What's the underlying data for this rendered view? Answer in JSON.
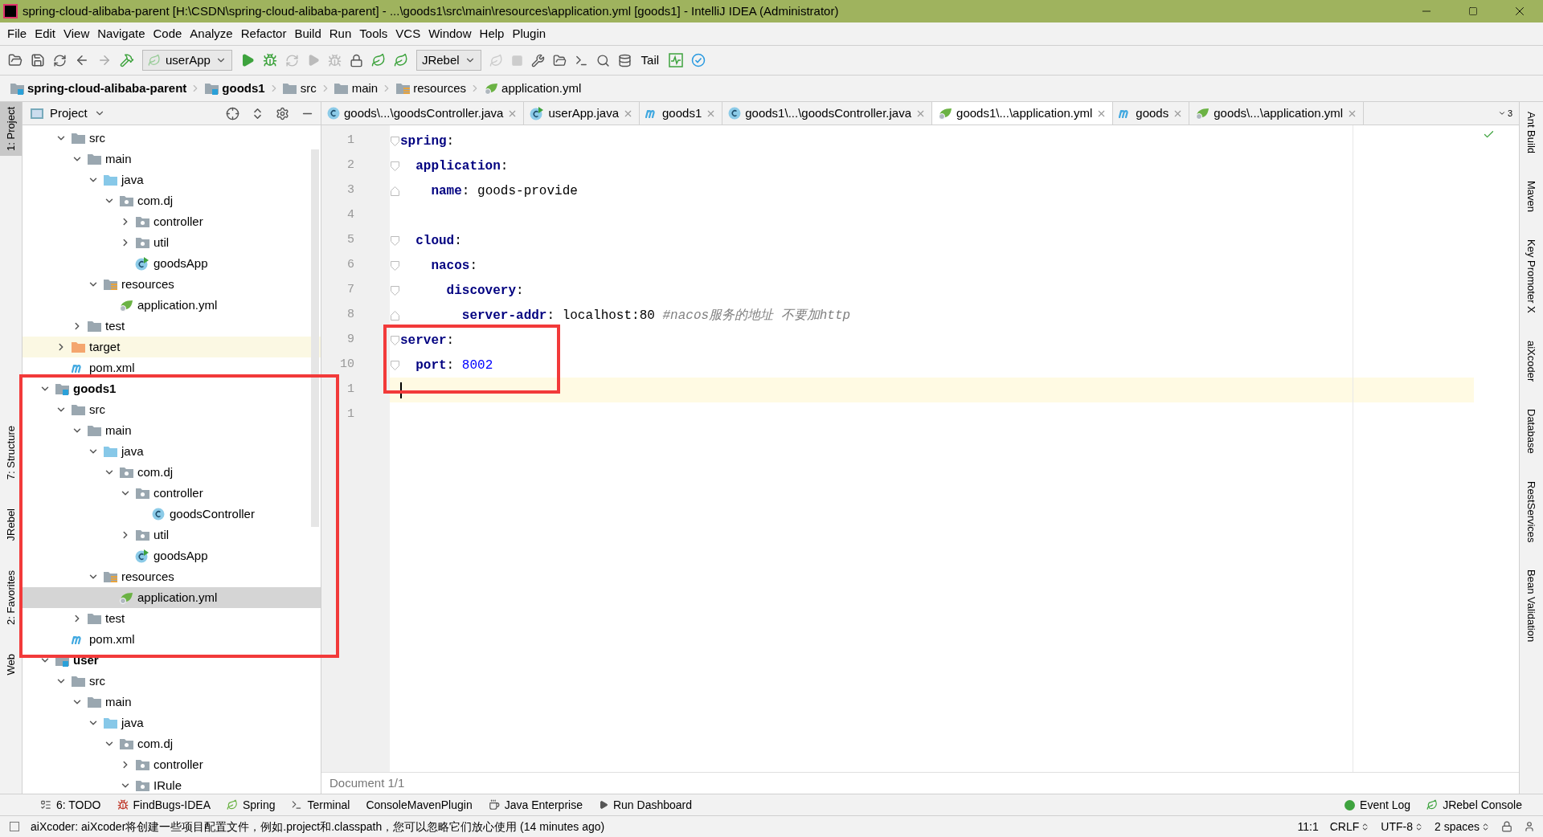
{
  "window": {
    "title": "spring-cloud-alibaba-parent [H:\\CSDN\\spring-cloud-alibaba-parent] - ...\\goods1\\src\\main\\resources\\application.yml [goods1] - IntelliJ IDEA (Administrator)"
  },
  "menu": [
    "File",
    "Edit",
    "View",
    "Navigate",
    "Code",
    "Analyze",
    "Refactor",
    "Build",
    "Run",
    "Tools",
    "VCS",
    "Window",
    "Help",
    "Plugin"
  ],
  "toolbar": {
    "run_config": "userApp",
    "jrebel_config": "JRebel",
    "tail": "Tail"
  },
  "breadcrumb": [
    {
      "label": "spring-cloud-alibaba-parent",
      "kind": "module"
    },
    {
      "label": "goods1",
      "kind": "module"
    },
    {
      "label": "src",
      "kind": "folder"
    },
    {
      "label": "main",
      "kind": "folder"
    },
    {
      "label": "resources",
      "kind": "resources"
    },
    {
      "label": "application.yml",
      "kind": "yml"
    }
  ],
  "left_strip": [
    {
      "label": "1: Project",
      "selected": true
    },
    {
      "label": "7: Structure",
      "selected": false
    },
    {
      "label": "JRebel",
      "selected": false
    },
    {
      "label": "2: Favorites",
      "selected": false
    },
    {
      "label": "Web",
      "selected": false
    }
  ],
  "project_panel": {
    "title": "Project"
  },
  "tree": [
    {
      "children": [
        {
          "label": "src",
          "kind": "folder",
          "expanded": true,
          "selected": false,
          "children": [
            {
              "label": "main",
              "kind": "folder",
              "expanded": true,
              "selected": false,
              "children": [
                {
                  "label": "java",
                  "kind": "source",
                  "expanded": true,
                  "selected": false,
                  "children": [
                    {
                      "label": "com.dj",
                      "kind": "package",
                      "expanded": true,
                      "selected": false,
                      "children": [
                        {
                          "label": "controller",
                          "kind": "package",
                          "expanded": false,
                          "selected": false
                        },
                        {
                          "label": "util",
                          "kind": "package",
                          "expanded": false,
                          "selected": false
                        },
                        {
                          "label": "goodsApp",
                          "kind": "app",
                          "selected": false
                        }
                      ]
                    }
                  ]
                },
                {
                  "label": "resources",
                  "kind": "resources",
                  "expanded": true,
                  "selected": false,
                  "children": [
                    {
                      "label": "application.yml",
                      "kind": "yml",
                      "selected": false
                    }
                  ]
                }
              ]
            },
            {
              "label": "test",
              "kind": "folder",
              "expanded": false,
              "selected": false
            }
          ]
        },
        {
          "label": "target",
          "kind": "excluded",
          "expanded": false,
          "selected": false
        },
        {
          "label": "pom.xml",
          "kind": "maven",
          "selected": false
        }
      ]
    },
    {
      "label": "goods1",
      "kind": "module",
      "expanded": true,
      "selected": false,
      "children": [
        {
          "label": "src",
          "kind": "folder",
          "expanded": true,
          "selected": false,
          "children": [
            {
              "label": "main",
              "kind": "folder",
              "expanded": true,
              "selected": false,
              "children": [
                {
                  "label": "java",
                  "kind": "source",
                  "expanded": true,
                  "selected": false,
                  "children": [
                    {
                      "label": "com.dj",
                      "kind": "package",
                      "expanded": true,
                      "selected": false,
                      "children": [
                        {
                          "label": "controller",
                          "kind": "package",
                          "expanded": true,
                          "selected": false,
                          "children": [
                            {
                              "label": "goodsController",
                              "kind": "class",
                              "selected": false
                            }
                          ]
                        },
                        {
                          "label": "util",
                          "kind": "package",
                          "expanded": false,
                          "selected": false
                        },
                        {
                          "label": "goodsApp",
                          "kind": "app",
                          "selected": false
                        }
                      ]
                    }
                  ]
                },
                {
                  "label": "resources",
                  "kind": "resources",
                  "expanded": true,
                  "selected": false,
                  "children": [
                    {
                      "label": "application.yml",
                      "kind": "yml",
                      "selected": true
                    }
                  ]
                }
              ]
            },
            {
              "label": "test",
              "kind": "folder",
              "expanded": false,
              "selected": false
            }
          ]
        },
        {
          "label": "pom.xml",
          "kind": "maven",
          "selected": false
        }
      ]
    },
    {
      "label": "user",
      "kind": "module",
      "expanded": true,
      "selected": false,
      "children": [
        {
          "label": "src",
          "kind": "folder",
          "expanded": true,
          "selected": false,
          "children": [
            {
              "label": "main",
              "kind": "folder",
              "expanded": true,
              "selected": false,
              "children": [
                {
                  "label": "java",
                  "kind": "source",
                  "expanded": true,
                  "selected": false,
                  "children": [
                    {
                      "label": "com.dj",
                      "kind": "package",
                      "expanded": true,
                      "selected": false,
                      "children": [
                        {
                          "label": "controller",
                          "kind": "package",
                          "expanded": false,
                          "selected": false
                        },
                        {
                          "label": "IRule",
                          "kind": "package",
                          "expanded": true,
                          "selected": false
                        }
                      ]
                    }
                  ]
                }
              ]
            }
          ]
        }
      ]
    }
  ],
  "tabs": [
    {
      "label": "goods\\...\\goodsController.java",
      "kind": "class",
      "selected": false
    },
    {
      "label": "userApp.java",
      "kind": "app",
      "selected": false
    },
    {
      "label": "goods1",
      "kind": "maven",
      "selected": false
    },
    {
      "label": "goods1\\...\\goodsController.java",
      "kind": "class",
      "selected": false
    },
    {
      "label": "goods1\\...\\application.yml",
      "kind": "yml",
      "selected": true
    },
    {
      "label": "goods",
      "kind": "maven",
      "selected": false
    },
    {
      "label": "goods\\...\\application.yml",
      "kind": "yml",
      "selected": false
    }
  ],
  "tab_overflow": "3",
  "editor": {
    "lines": [
      {
        "number": "1",
        "key": "spring",
        "colon": ":",
        "current": false
      },
      {
        "number": "2",
        "key": "  application",
        "colon": ":",
        "current": false
      },
      {
        "number": "3",
        "key": "    name",
        "colon": ":",
        "value": "goods-provide",
        "current": false
      },
      {
        "number": "4",
        "current": false
      },
      {
        "number": "5",
        "key": "  cloud",
        "colon": ":",
        "current": false
      },
      {
        "number": "6",
        "key": "    nacos",
        "colon": ":",
        "current": false
      },
      {
        "number": "7",
        "key": "      discovery",
        "colon": ":",
        "current": false
      },
      {
        "number": "8",
        "key": "        server-addr",
        "colon": ":",
        "value": "localhost:80",
        "comment": "#nacos服务的地址 不要加http",
        "current": false
      },
      {
        "number": "9",
        "key": "server",
        "colon": ":",
        "current": false
      },
      {
        "number": "10",
        "key": "  port",
        "colon": ":",
        "numeric": "8002",
        "current": false
      },
      {
        "number": "1",
        "current": true
      },
      {
        "number": "1",
        "current": false
      }
    ],
    "footer": "Document 1/1"
  },
  "right_strip": [
    "Ant Build",
    "Maven",
    "Key Promoter X",
    "aiXcoder",
    "Database",
    "RestServices",
    "Bean Validation"
  ],
  "bottom_tabs": [
    {
      "label": "6: TODO",
      "kind": "todo"
    },
    {
      "label": "FindBugs-IDEA",
      "kind": "bug"
    },
    {
      "label": "Spring",
      "kind": "spring"
    },
    {
      "label": "Terminal",
      "kind": "terminal"
    },
    {
      "label": "ConsoleMavenPlugin",
      "kind": "plain"
    },
    {
      "label": "Java Enterprise",
      "kind": "enterprise"
    },
    {
      "label": "Run Dashboard",
      "kind": "run"
    }
  ],
  "bottom_tabs_right": [
    {
      "label": "Event Log",
      "kind": "event"
    },
    {
      "label": "JRebel Console",
      "kind": "jrebel"
    }
  ],
  "status_bar": {
    "message": "aiXcoder: aiXcoder将创建一些项目配置文件，例如.project和.classpath，您可以忽略它们放心使用 (14 minutes ago)",
    "position": "11:1",
    "line_separator": "CRLF",
    "encoding": "UTF-8",
    "indent": "2 spaces"
  }
}
